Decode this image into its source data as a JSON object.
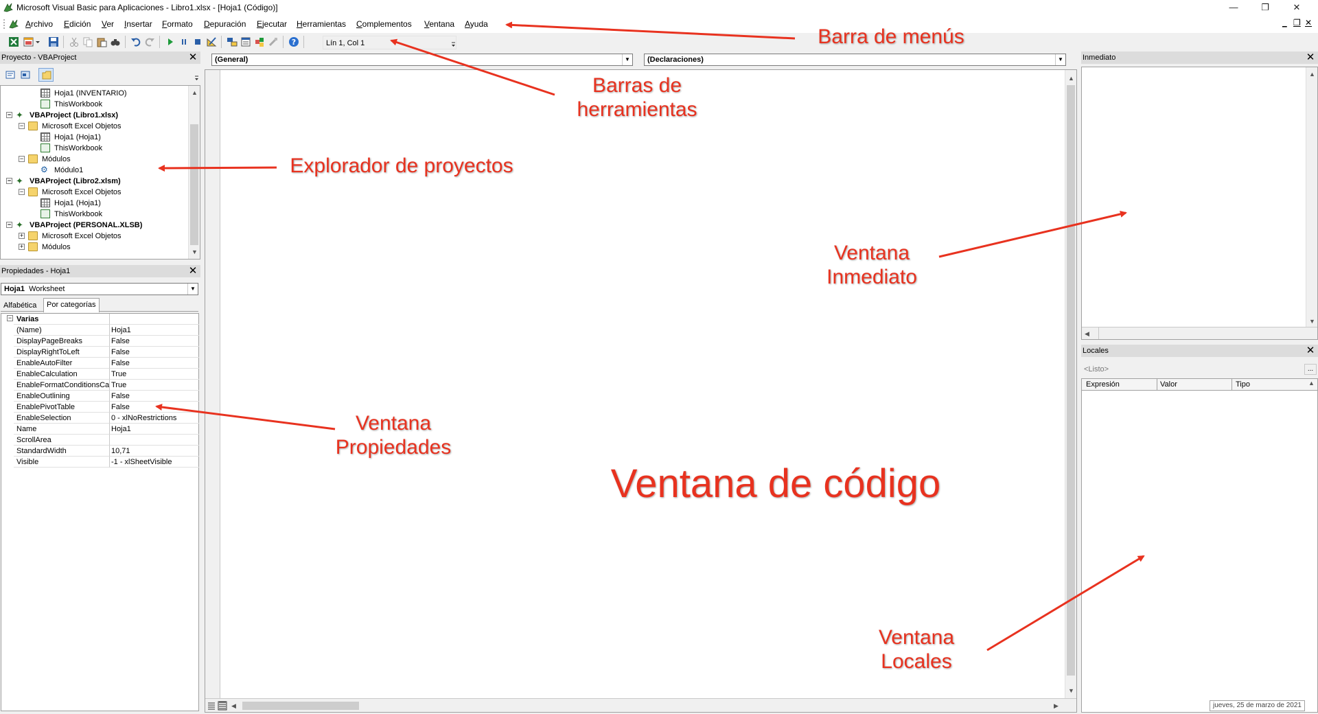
{
  "window": {
    "title": "Microsoft Visual Basic para Aplicaciones - Libro1.xlsx - [Hoja1 (Código)]",
    "minimize_glyph": "—",
    "restore_glyph": "❐",
    "close_glyph": "✕"
  },
  "menubar": {
    "items": [
      "Archivo",
      "Edición",
      "Ver",
      "Insertar",
      "Formato",
      "Depuración",
      "Ejecutar",
      "Herramientas",
      "Complementos",
      "Ventana",
      "Ayuda"
    ],
    "doc_controls": [
      "_",
      "❐",
      "✕"
    ]
  },
  "toolbar": {
    "position_label": "Lín 1, Col 1",
    "icons": [
      "excel-icon",
      "insert-icon",
      "save-icon",
      "cut-icon",
      "copy-icon",
      "paste-icon",
      "find-icon",
      "undo-icon",
      "redo-icon",
      "run-icon",
      "pause-icon",
      "stop-icon",
      "design-mode-icon",
      "project-explorer-icon",
      "properties-icon",
      "object-browser-icon",
      "toolbox-icon",
      "help-icon"
    ]
  },
  "project_pane": {
    "title": "Proyecto - VBAProject",
    "tree": [
      {
        "label": "Hoja1 (INVENTARIO)",
        "icon": "sheet",
        "level": 3,
        "bold": false,
        "expander": ""
      },
      {
        "label": "ThisWorkbook",
        "icon": "workbook",
        "level": 3,
        "bold": false,
        "expander": ""
      },
      {
        "label": "VBAProject (Libro1.xlsx)",
        "icon": "vba",
        "level": 1,
        "bold": true,
        "expander": "−"
      },
      {
        "label": "Microsoft Excel Objetos",
        "icon": "folder",
        "level": 2,
        "bold": false,
        "expander": "−"
      },
      {
        "label": "Hoja1 (Hoja1)",
        "icon": "sheet",
        "level": 3,
        "bold": false,
        "expander": ""
      },
      {
        "label": "ThisWorkbook",
        "icon": "workbook",
        "level": 3,
        "bold": false,
        "expander": ""
      },
      {
        "label": "Módulos",
        "icon": "folder",
        "level": 2,
        "bold": false,
        "expander": "−"
      },
      {
        "label": "Módulo1",
        "icon": "module",
        "level": 3,
        "bold": false,
        "expander": ""
      },
      {
        "label": "VBAProject (Libro2.xlsm)",
        "icon": "vba",
        "level": 1,
        "bold": true,
        "expander": "−"
      },
      {
        "label": "Microsoft Excel Objetos",
        "icon": "folder",
        "level": 2,
        "bold": false,
        "expander": "−"
      },
      {
        "label": "Hoja1 (Hoja1)",
        "icon": "sheet",
        "level": 3,
        "bold": false,
        "expander": ""
      },
      {
        "label": "ThisWorkbook",
        "icon": "workbook",
        "level": 3,
        "bold": false,
        "expander": ""
      },
      {
        "label": "VBAProject (PERSONAL.XLSB)",
        "icon": "vba",
        "level": 1,
        "bold": true,
        "expander": "−"
      },
      {
        "label": "Microsoft Excel Objetos",
        "icon": "folder",
        "level": 2,
        "bold": false,
        "expander": "+"
      },
      {
        "label": "Módulos",
        "icon": "folder",
        "level": 2,
        "bold": false,
        "expander": "+"
      }
    ]
  },
  "properties_pane": {
    "title": "Propiedades - Hoja1",
    "object_name": "Hoja1",
    "object_type": "Worksheet",
    "tabs": [
      "Alfabética",
      "Por categorías"
    ],
    "active_tab": "Por categorías",
    "category": "Varias",
    "rows": [
      {
        "name": "(Name)",
        "value": "Hoja1"
      },
      {
        "name": "DisplayPageBreaks",
        "value": "False"
      },
      {
        "name": "DisplayRightToLeft",
        "value": "False"
      },
      {
        "name": "EnableAutoFilter",
        "value": "False"
      },
      {
        "name": "EnableCalculation",
        "value": "True"
      },
      {
        "name": "EnableFormatConditionsCalc",
        "value": "True"
      },
      {
        "name": "EnableOutlining",
        "value": "False"
      },
      {
        "name": "EnablePivotTable",
        "value": "False"
      },
      {
        "name": "EnableSelection",
        "value": "0 - xlNoRestrictions"
      },
      {
        "name": "Name",
        "value": "Hoja1"
      },
      {
        "name": "ScrollArea",
        "value": ""
      },
      {
        "name": "StandardWidth",
        "value": "10,71"
      },
      {
        "name": "Visible",
        "value": "-1 - xlSheetVisible"
      }
    ]
  },
  "code_pane": {
    "object_combo": "(General)",
    "procedure_combo": "(Declaraciones)"
  },
  "immediate_pane": {
    "title": "Inmediato"
  },
  "locals_pane": {
    "title": "Locales",
    "context": "<Listo>",
    "ellipsis": "...",
    "columns": [
      "Expresión",
      "Valor",
      "Tipo"
    ]
  },
  "statusbar": {
    "date": "jueves, 25 de marzo de 2021"
  },
  "annotations": {
    "menubar": "Barra de menús",
    "toolbars": "Barras de\nherramientas",
    "project_explorer": "Explorador de proyectos",
    "immediate": "Ventana\nInmediato",
    "properties": "Ventana\nPropiedades",
    "code": "Ventana de código",
    "locals": "Ventana\nLocales"
  },
  "colors": {
    "annotation_red": "#e8321f",
    "pane_title_bg": "#dcdcdc",
    "window_bg": "#f0f0f0"
  }
}
